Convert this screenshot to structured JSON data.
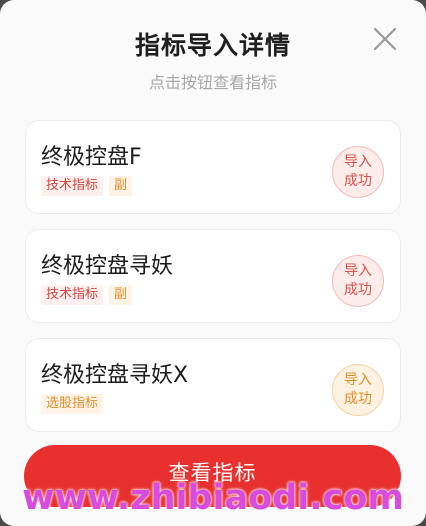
{
  "dialog": {
    "title": "指标导入详情",
    "subtitle": "点击按钮查看指标",
    "close_icon": "close-icon"
  },
  "items": [
    {
      "name": "终极控盘F",
      "tags": [
        {
          "text": "技术指标",
          "color": "red"
        },
        {
          "text": "副",
          "color": "orange"
        }
      ],
      "status_line1": "导入",
      "status_line2": "成功",
      "status_color": "red"
    },
    {
      "name": "终极控盘寻妖",
      "tags": [
        {
          "text": "技术指标",
          "color": "red"
        },
        {
          "text": "副",
          "color": "orange"
        }
      ],
      "status_line1": "导入",
      "status_line2": "成功",
      "status_color": "red"
    },
    {
      "name": "终极控盘寻妖X",
      "tags": [
        {
          "text": "选股指标",
          "color": "orange"
        }
      ],
      "status_line1": "导入",
      "status_line2": "成功",
      "status_color": "orange"
    }
  ],
  "button": {
    "label": "查看指标"
  },
  "watermark": "www.zhibiaodi.com",
  "colors": {
    "accent": "#e8312f",
    "tag_red": "#d8413c",
    "tag_orange": "#e48e2a",
    "watermark": "#d94bdc"
  }
}
